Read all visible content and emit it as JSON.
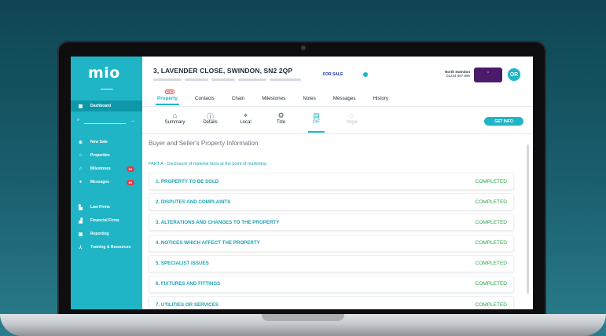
{
  "sidebar": {
    "logo": "mio",
    "items": [
      {
        "label": "Dashboard",
        "icon": "grid-icon"
      },
      {
        "label": "New Sale",
        "icon": "plus-circle-icon"
      },
      {
        "label": "Properties",
        "icon": "home-icon"
      },
      {
        "label": "Milestones",
        "icon": "bell-icon",
        "badge": "99"
      },
      {
        "label": "Messages",
        "icon": "chat-icon",
        "badge": "99"
      },
      {
        "label": "Law Firms",
        "icon": "building-icon"
      },
      {
        "label": "Financial Firms",
        "icon": "bank-icon"
      },
      {
        "label": "Reporting",
        "icon": "chart-icon"
      },
      {
        "label": "Training & Resources",
        "icon": "network-icon"
      }
    ]
  },
  "header": {
    "address": "3, LAVENDER CLOSE, SWINDON, SN2 2QP",
    "status": "FOR SALE",
    "branch_name": "North Swindon",
    "branch_phone": "01234 567 890",
    "avatar_initials": "OR"
  },
  "tabs": [
    {
      "label": "Property",
      "new": "NEW"
    },
    {
      "label": "Contacts"
    },
    {
      "label": "Chain"
    },
    {
      "label": "Milestones"
    },
    {
      "label": "Notes"
    },
    {
      "label": "Messages"
    },
    {
      "label": "History"
    }
  ],
  "subtabs": [
    {
      "label": "Summary",
      "icon": "⌂"
    },
    {
      "label": "Details",
      "icon": "ⓘ"
    },
    {
      "label": "Local",
      "icon": "⌖"
    },
    {
      "label": "Title",
      "icon": "⚙"
    },
    {
      "label": "PIF",
      "icon": "▤"
    },
    {
      "label": "Veya",
      "icon": "⌂"
    }
  ],
  "get_info_label": "GET INFO",
  "page_title": "Buyer and Seller's Property Information",
  "part_label": "PART A - Disclosure of material facts at the point of marketing",
  "sections": [
    {
      "title": "1. PROPERTY TO BE SOLD",
      "status": "COMPLETED"
    },
    {
      "title": "2. DISPUTES AND COMPLAINTS",
      "status": "COMPLETED"
    },
    {
      "title": "3. ALTERATIONS AND CHANGES TO THE PROPERTY",
      "status": "COMPLETED"
    },
    {
      "title": "4. NOTICES WHICH AFFECT THE PROPERTY",
      "status": "COMPLETED"
    },
    {
      "title": "5. SPECIALIST ISSUES",
      "status": "COMPLETED"
    },
    {
      "title": "6. FIXTURES AND FITTINGS",
      "status": "COMPLETED"
    },
    {
      "title": "7. UTILITIES OR SERVICES",
      "status": "COMPLETED"
    }
  ],
  "colors": {
    "accent": "#1fb5c6",
    "completed": "#2aa84a",
    "badge": "#e53945"
  }
}
